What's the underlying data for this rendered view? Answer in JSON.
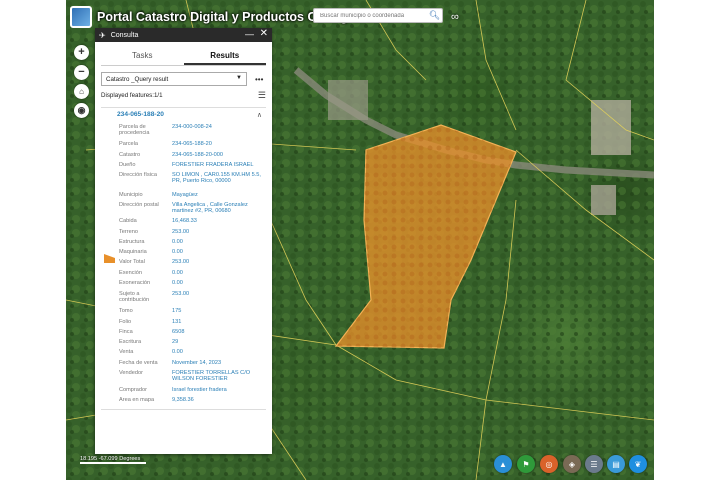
{
  "header": {
    "title": "Portal Catastro Digital y Productos Cartográficos",
    "search_placeholder": "Buscar municipio o coordenada"
  },
  "panel": {
    "title": "Consulta",
    "tabs": [
      {
        "label": "Tasks",
        "active": false
      },
      {
        "label": "Results",
        "active": true
      }
    ],
    "query_select": "Catastro _Query result",
    "displayed_features": "Displayed features:1/1",
    "feature_id": "234-065-188-20",
    "attributes": [
      {
        "key": "Parcela de procedencia",
        "value": "234-000-008-24"
      },
      {
        "key": "Parcela",
        "value": "234-065-188-20"
      },
      {
        "key": "Catastro",
        "value": "234-065-188-20-000"
      },
      {
        "key": "Dueño",
        "value": "FORESTIER FRADERA ISRAEL"
      },
      {
        "key": "Dirección física",
        "value": "SO LIMON , CAR0.155 KM.HM 5.5, PR, Puerto Rico, 00000"
      },
      {
        "key": "Municipio",
        "value": "Mayagüez"
      },
      {
        "key": "Dirección postal",
        "value": "Villa Angelica , Calle Gonzalez martinez #2, PR, 00680"
      },
      {
        "key": "Cabida",
        "value": "16,468.33"
      },
      {
        "key": "Terreno",
        "value": "253.00"
      },
      {
        "key": "Estructura",
        "value": "0.00"
      },
      {
        "key": "Maquinaria",
        "value": "0.00"
      },
      {
        "key": "Valor Total",
        "value": "253.00"
      },
      {
        "key": "Exención",
        "value": "0.00"
      },
      {
        "key": "Exoneración",
        "value": "0.00"
      },
      {
        "key": "Sujeto a contribución",
        "value": "253.00"
      },
      {
        "key": "Tomo",
        "value": "175"
      },
      {
        "key": "Folio",
        "value": "131"
      },
      {
        "key": "Finca",
        "value": "6508"
      },
      {
        "key": "Escritura",
        "value": "29"
      },
      {
        "key": "Venta",
        "value": "0.00"
      },
      {
        "key": "Fecha de venta",
        "value": "November 14, 2023"
      },
      {
        "key": "Vendedor",
        "value": "FORESTIER TORRELLAS C/O WILSON FORESTIER"
      },
      {
        "key": "Comprador",
        "value": "Israel forestier fradera"
      },
      {
        "key": "Area en mapa",
        "value": "9,358.36"
      }
    ]
  },
  "coords": "18.195 -67.099 Degrees",
  "icons": {
    "app_logo": "app-logo-icon",
    "search": "search-icon",
    "link": "link-icon",
    "zoom_in": "plus-icon",
    "zoom_out": "minus-icon",
    "home": "home-icon",
    "locate": "locate-icon",
    "widgets": [
      "basemap-gallery-icon",
      "flag-icon",
      "measure-icon",
      "layers-icon",
      "list-icon",
      "folder-icon",
      "cart-icon"
    ]
  },
  "colors": {
    "parcel_fill": "#e8902a",
    "panel_header": "#2a2a2a",
    "link_blue": "#2a7fb6"
  }
}
